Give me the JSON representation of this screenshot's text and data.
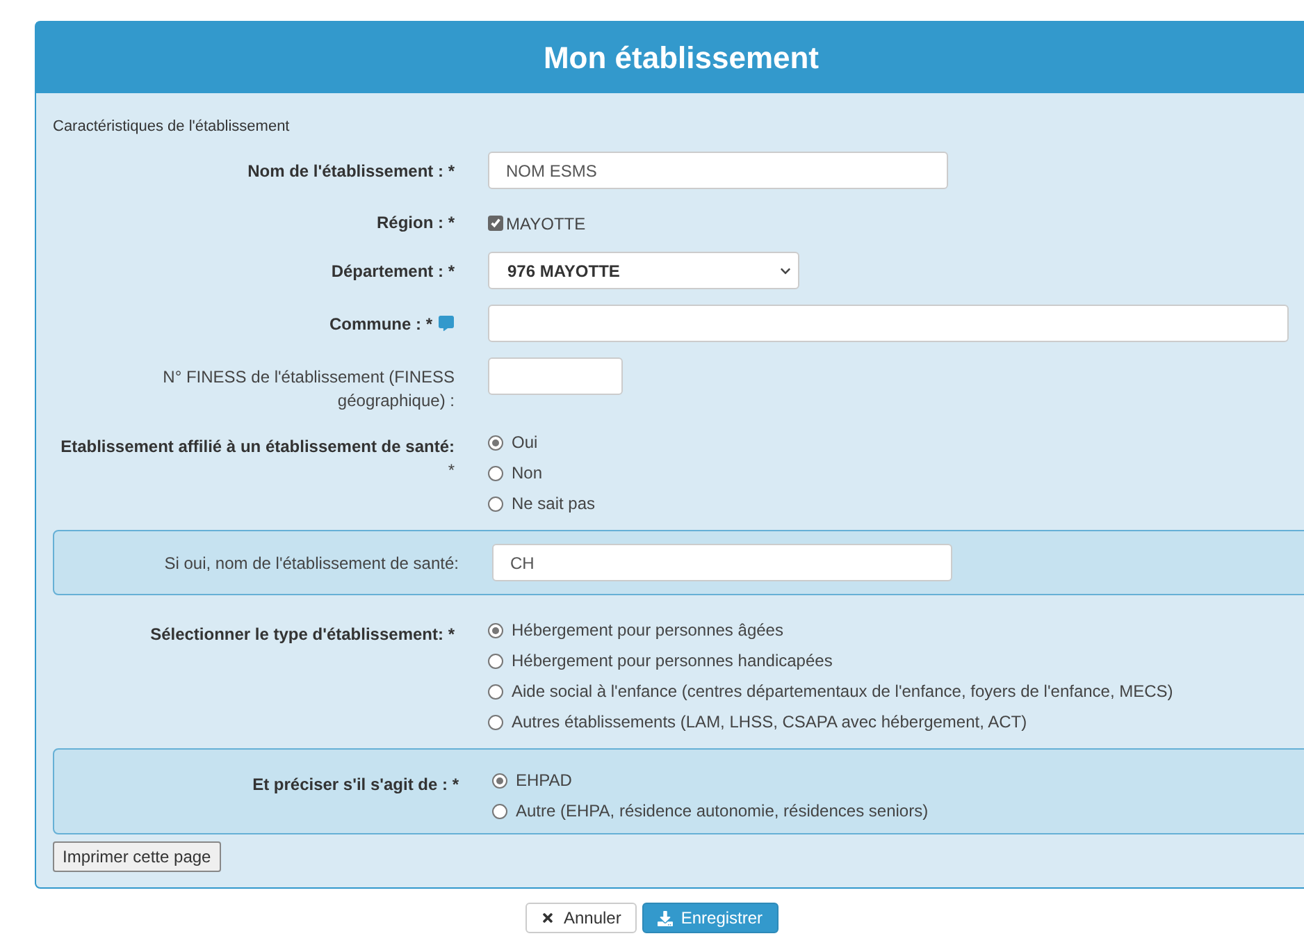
{
  "title": "Mon établissement",
  "section_title": "Caractéristiques de l'établissement",
  "fields": [
    {
      "kind": "text",
      "label": "Nom de l'établissement : *",
      "bold": true,
      "value": "NOM ESMS"
    },
    {
      "kind": "checkbox",
      "label": "Région : *",
      "bold": true,
      "option": "MAYOTTE",
      "checked": true
    },
    {
      "kind": "select",
      "label": "Département : *",
      "bold": true,
      "value": "976 MAYOTTE"
    },
    {
      "kind": "text",
      "label": "Commune : *",
      "bold": true,
      "comment_icon": true
    },
    {
      "kind": "text",
      "label": "N° FINESS de l'établissement (FINESS géographique) :",
      "bold": false
    },
    {
      "kind": "radio",
      "label": "Etablissement affilié à un établissement de santé:",
      "bold": true,
      "required_mark": "*",
      "options": [
        {
          "label": "Oui",
          "selected": true
        },
        {
          "label": "Non",
          "selected": false
        },
        {
          "label": "Ne sait pas",
          "selected": false
        }
      ]
    },
    {
      "kind": "text",
      "label": "Si oui, nom de l'établissement de santé:",
      "bold": false,
      "value": "CH",
      "boxed": true
    },
    {
      "kind": "radio",
      "label": "Sélectionner le type d'établissement: *",
      "bold": true,
      "options": [
        {
          "label": "Hébergement pour personnes âgées",
          "selected": true
        },
        {
          "label": "Hébergement pour personnes handicapées",
          "selected": false
        },
        {
          "label": "Aide social à l'enfance (centres départementaux de l'enfance, foyers de l'enfance, MECS)",
          "selected": false
        },
        {
          "label": "Autres établissements (LAM, LHSS, CSAPA avec hébergement, ACT)",
          "selected": false
        }
      ]
    },
    {
      "kind": "radio",
      "label": "Et préciser s'il s'agit de : *",
      "bold": true,
      "boxed": true,
      "options": [
        {
          "label": "EHPAD",
          "selected": true
        },
        {
          "label": "Autre (EHPA, résidence autonomie, résidences seniors)",
          "selected": false
        }
      ]
    }
  ],
  "print_button": "Imprimer cette page",
  "cancel_button": "Annuler",
  "save_button": "Enregistrer"
}
